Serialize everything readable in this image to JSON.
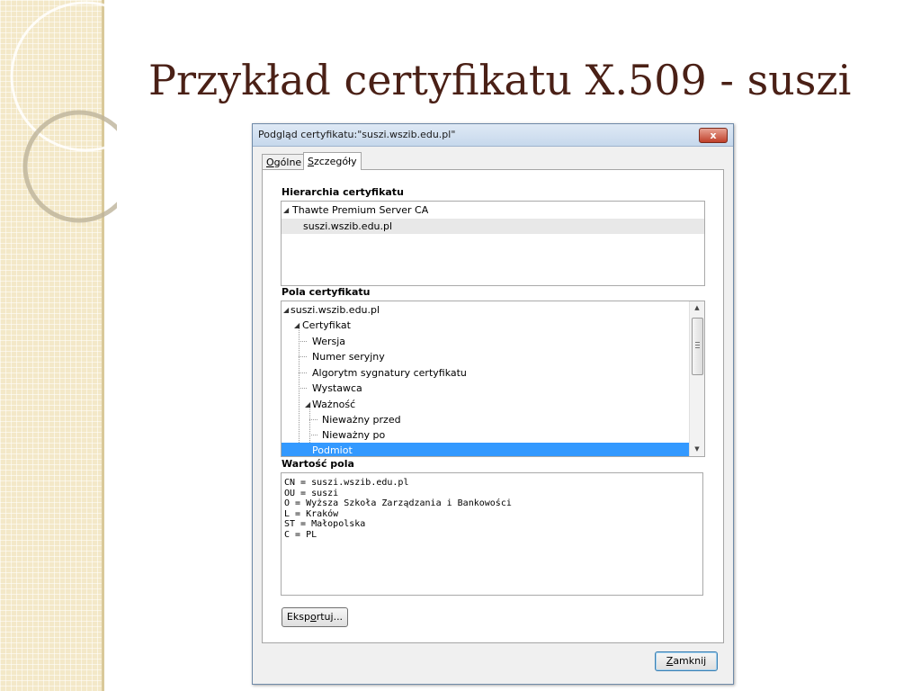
{
  "slide": {
    "title": "Przykład certyfikatu X.509 - suszi"
  },
  "dialog": {
    "title": "Podgląd certyfikatu:\"suszi.wszib.edu.pl\"",
    "close_label": "x",
    "tabs": [
      {
        "pre": "",
        "accel": "O",
        "post": "gólne",
        "active": false
      },
      {
        "pre": "",
        "accel": "S",
        "post": "zczegóły",
        "active": true
      }
    ],
    "hierarchy": {
      "label": "Hierarchia certyfikatu",
      "items": [
        {
          "text": "Thawte Premium Server CA"
        },
        {
          "text": "suszi.wszib.edu.pl"
        }
      ]
    },
    "fields": {
      "label": "Pola certyfikatu",
      "items": [
        {
          "text": "suszi.wszib.edu.pl"
        },
        {
          "text": "Certyfikat"
        },
        {
          "text": "Wersja"
        },
        {
          "text": "Numer seryjny"
        },
        {
          "text": "Algorytm sygnatury certyfikatu"
        },
        {
          "text": "Wystawca"
        },
        {
          "text": "Ważność"
        },
        {
          "text": "Nieważny przed"
        },
        {
          "text": "Nieważny po"
        },
        {
          "text": "Podmiot"
        }
      ]
    },
    "value": {
      "label": "Wartość pola",
      "lines": [
        "CN = suszi.wszib.edu.pl",
        "OU = suszi",
        "O = Wyższa Szkoła Zarządzania i Bankowości",
        "L = Kraków",
        "ST = Małopolska",
        "C = PL"
      ]
    },
    "export_button": {
      "pre": "Eksp",
      "accel": "o",
      "post": "rtuj..."
    },
    "close_button": {
      "pre": "",
      "accel": "Z",
      "post": "amknij"
    }
  }
}
